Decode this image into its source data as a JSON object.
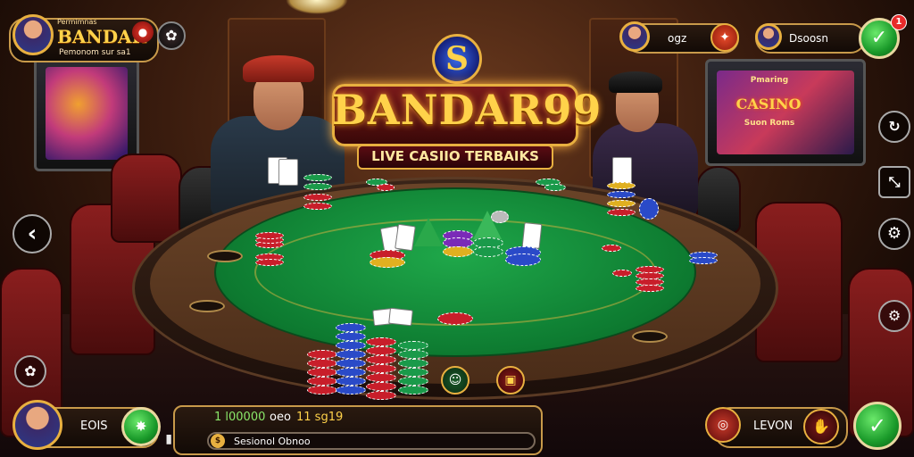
{
  "logo": {
    "title": "BANDAR99",
    "subtitle": "LIVE CASIIO TERBAIKS",
    "emblem_glyph": "S"
  },
  "profile": {
    "brand_small": "Permimnas",
    "name": "BANDAR",
    "subtitle": "Pemonom sur sa1"
  },
  "top_right": {
    "box1_label": "ogz",
    "box2_label": "Dsoosn"
  },
  "slot_machine": {
    "title": "CASINO",
    "small_top": "Pmaring",
    "small_bottom": "Suon Roms"
  },
  "bottom_left": {
    "label": "EOIS"
  },
  "bottom_center": {
    "amount_left": "1 l00000",
    "amount_mid": "oeo",
    "amount_right": "11 sg19",
    "input_placeholder": "Sesionol Obnoo"
  },
  "bottom_right": {
    "label": "LEVON"
  },
  "notification_count": "1",
  "icons": [
    "profile-avatar",
    "chips-icon",
    "settings-icon",
    "check-icon",
    "rotate-icon",
    "fullscreen-off-icon",
    "gear-icon",
    "back-arrow-icon",
    "emote-icon",
    "trophy-icon",
    "hand-icon"
  ],
  "colors": {
    "gold": "#e8b040",
    "felt": "#0d7a30",
    "accent_green": "#1a9a2a"
  }
}
